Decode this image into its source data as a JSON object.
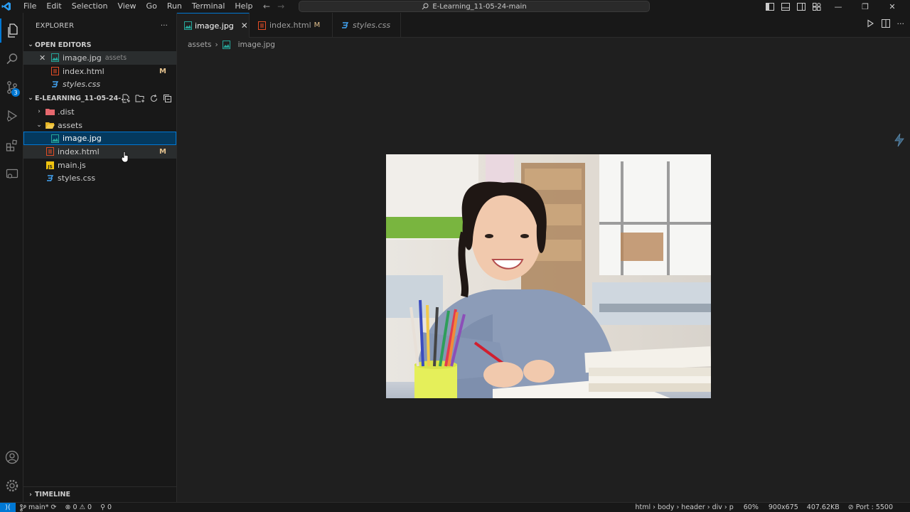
{
  "titlebar": {
    "menu": [
      "File",
      "Edit",
      "Selection",
      "View",
      "Go",
      "Run",
      "Terminal",
      "Help"
    ],
    "search": "E-Learning_11-05-24-main",
    "window_min": "—",
    "window_max": "❐",
    "window_close": "✕"
  },
  "activity": {
    "source_control_badge": "3"
  },
  "sidebar": {
    "title": "EXPLORER",
    "more": "···",
    "open_editors_label": "OPEN EDITORS",
    "open_editors": [
      {
        "name": "image.jpg",
        "desc": "assets",
        "mod": ""
      },
      {
        "name": "index.html",
        "desc": "",
        "mod": "M"
      },
      {
        "name": "styles.css",
        "desc": "",
        "mod": ""
      }
    ],
    "workspace_label": "E-LEARNING_11-05-24-...",
    "tree": [
      {
        "name": ".dist",
        "mod": ""
      },
      {
        "name": "assets",
        "mod": ""
      },
      {
        "name": "image.jpg",
        "mod": ""
      },
      {
        "name": "index.html",
        "mod": "M"
      },
      {
        "name": "main.js",
        "mod": ""
      },
      {
        "name": "styles.css",
        "mod": ""
      }
    ],
    "timeline_label": "TIMELINE"
  },
  "tabs": [
    {
      "label": "image.jpg",
      "mod": "",
      "close": "✕"
    },
    {
      "label": "index.html",
      "mod": "M"
    },
    {
      "label": "styles.css",
      "mod": ""
    }
  ],
  "breadcrumb": {
    "folder": "assets",
    "file": "image.jpg"
  },
  "statusbar": {
    "branch": "main*",
    "errors": "0",
    "warnings": "0",
    "ports": "0",
    "path": "html › body › header › div › p",
    "zoom": "60%",
    "dimensions": "900x675",
    "size": "407.62KB",
    "port": "Port : 5500"
  },
  "colors": {
    "accent": "#0078d4",
    "modified": "#e2c08d",
    "html_icon": "#e44d26",
    "css_icon": "#42a5f5",
    "js_icon": "#f1c40f",
    "image_icon": "#26a69a"
  }
}
